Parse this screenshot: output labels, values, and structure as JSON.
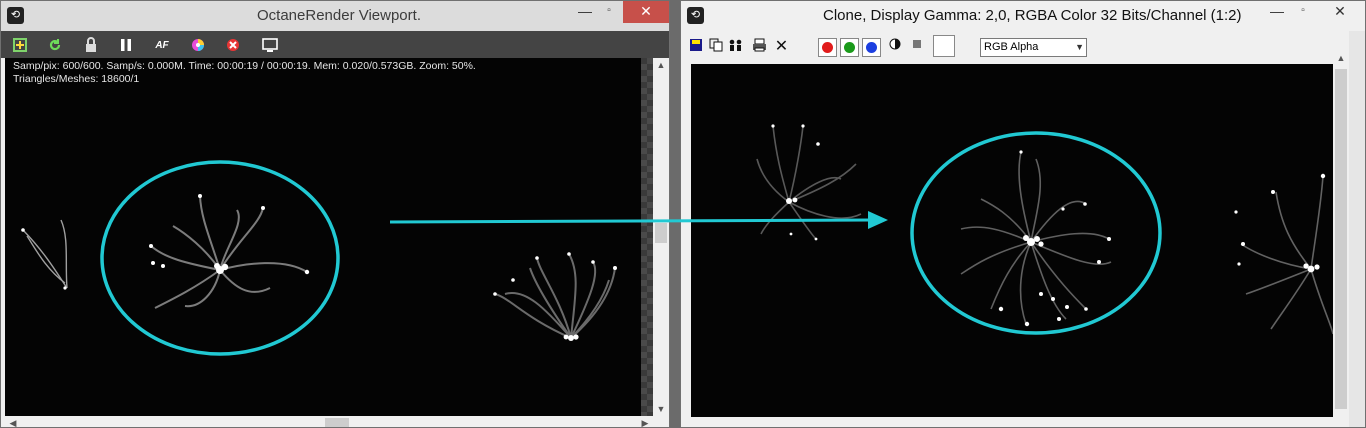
{
  "left_window": {
    "title": "OctaneRender Viewport.",
    "minimize_glyph": "—",
    "close_glyph": "✕",
    "toolbar_icons": [
      "import-icon",
      "refresh-icon",
      "lock-icon",
      "pause-icon",
      "af-icon",
      "color-wheel-icon",
      "clear-icon",
      "display-icon"
    ],
    "af_label": "AF",
    "info_line1": "Samp/pix: 600/600.   Samp/s: 0.000M.   Time: 00:00:19 / 00:00:19.   Mem: 0.020/0.573GB.   Zoom: 50%.",
    "info_line2": "Triangles/Meshes: 18600/1"
  },
  "right_window": {
    "title": "Clone, Display Gamma: 2,0, RGBA Color 32 Bits/Channel (1:2)",
    "minimize_glyph": "—",
    "close_glyph": "✕",
    "channel_select": "RGB Alpha",
    "channel_colors": {
      "red": "#e11b1b",
      "green": "#1a9a1a",
      "blue": "#1c3fe0"
    }
  },
  "annotation": {
    "color": "#21c9d3"
  }
}
